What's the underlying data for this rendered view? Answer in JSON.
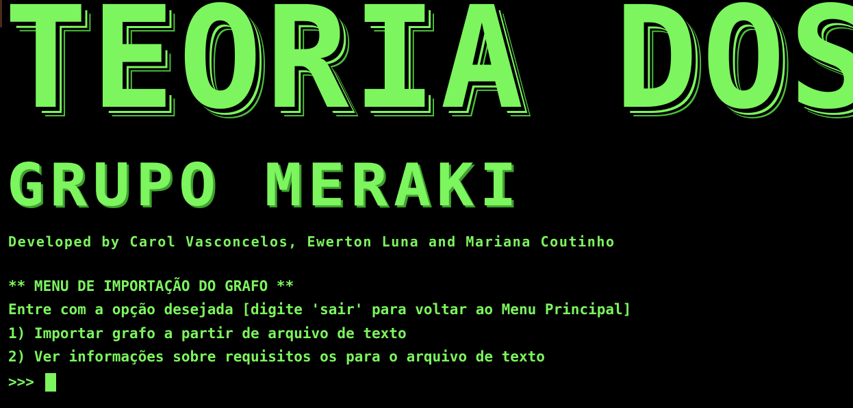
{
  "theme": {
    "background": "#000000",
    "text_color": "#7CF55E"
  },
  "banner": {
    "title": "TEORIA DOS",
    "subtitle": "GRUPO MERAKI"
  },
  "credits": "Developed by Carol Vasconcelos, Ewerton Luna and Mariana Coutinho",
  "menu": {
    "title": "** MENU DE IMPORTAÇÃO DO GRAFO **",
    "instruction": "Entre com a opção desejada [digite 'sair' para voltar ao Menu Principal]",
    "options": [
      "1) Importar grafo a partir de arquivo de texto",
      "2) Ver informações sobre requisitos os para o arquivo de texto"
    ]
  },
  "prompt": {
    "symbol": ">>>",
    "input_value": ""
  }
}
